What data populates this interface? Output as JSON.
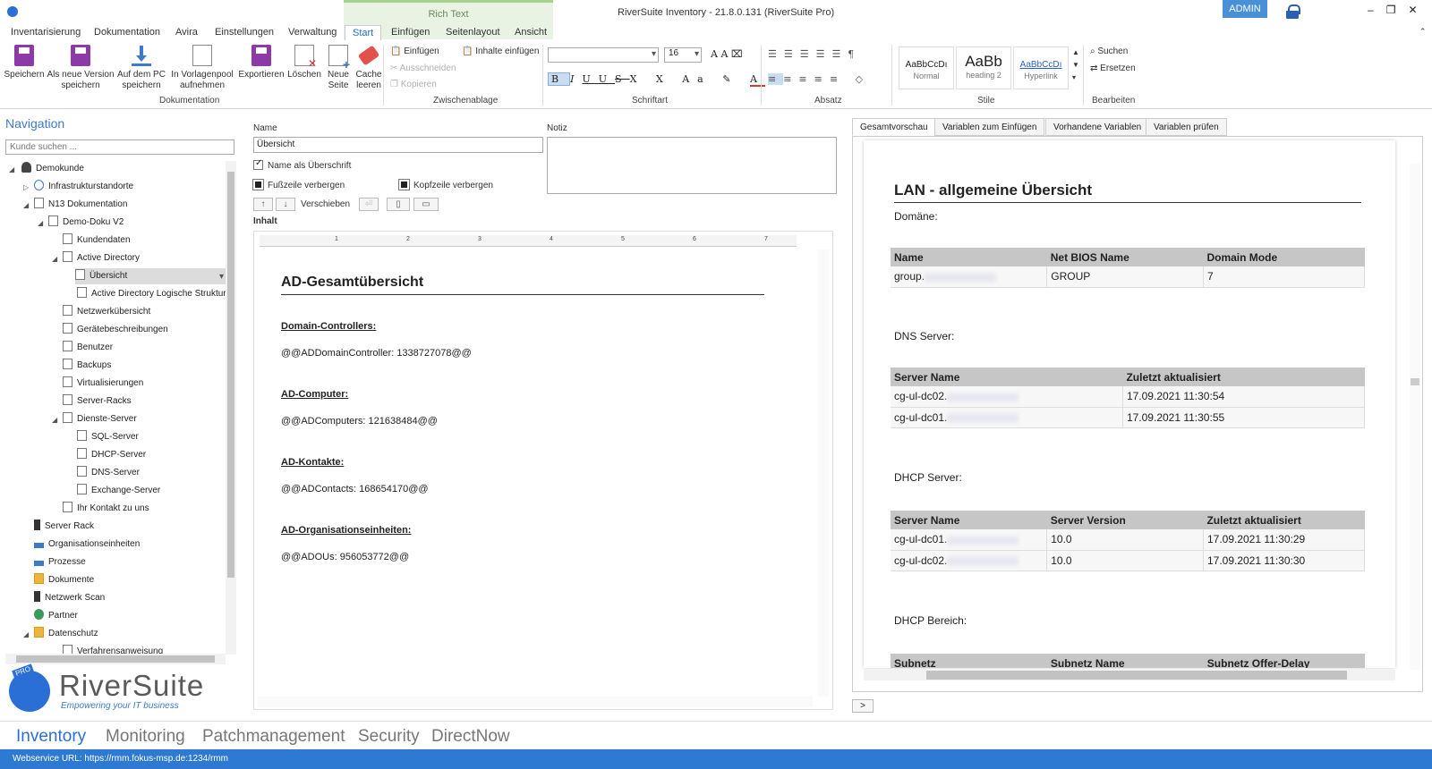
{
  "window": {
    "title": "RiverSuite Inventory - 21.8.0.131 (RiverSuite Pro)",
    "admin_label": "ADMIN",
    "context_title": "Rich Text"
  },
  "menu_tabs": [
    "Inventarisierung",
    "Dokumentation",
    "Avira",
    "Einstellungen",
    "Verwaltung",
    "Start",
    "Einfügen",
    "Seitenlayout",
    "Ansicht"
  ],
  "ribbon": {
    "doc_buttons": [
      {
        "label1": "Speichern",
        "label2": ""
      },
      {
        "label1": "Als neue Version",
        "label2": "speichern"
      },
      {
        "label1": "Auf dem PC",
        "label2": "speichern"
      },
      {
        "label1": "In Vorlagenpool",
        "label2": "aufnehmen"
      },
      {
        "label1": "Exportieren",
        "label2": ""
      },
      {
        "label1": "Löschen",
        "label2": ""
      },
      {
        "label1": "Neue",
        "label2": "Seite"
      },
      {
        "label1": "Cache",
        "label2": "leeren"
      }
    ],
    "group_doc": "Dokumentation",
    "clipboard": {
      "paste": "Einfügen",
      "cut": "Ausschneiden",
      "copy": "Kopieren",
      "paste_content": "Inhalte einfügen",
      "group": "Zwischenablage"
    },
    "font": {
      "size": "16",
      "group": "Schriftart"
    },
    "paragraph_group": "Absatz",
    "styles": [
      {
        "preview": "AaBbCcDı",
        "name": "Normal"
      },
      {
        "preview": "AaBb",
        "name": "heading 2"
      },
      {
        "preview": "AaBbCcDı",
        "name": "Hyperlink"
      }
    ],
    "styles_group": "Stile",
    "edit": {
      "search": "Suchen",
      "replace": "Ersetzen",
      "group": "Bearbeiten"
    }
  },
  "navigation": {
    "title": "Navigation",
    "search_placeholder": "Kunde suchen ...",
    "tree": [
      "Demokunde",
      "Infrastrukturstandorte",
      "N13 Dokumentation",
      "Demo-Doku V2",
      "Kundendaten",
      "Active Directory",
      "Übersicht",
      "Active Directory Logische Struktur",
      "Netzwerkübersicht",
      "Gerätebeschreibungen",
      "Benutzer",
      "Backups",
      "Virtualisierungen",
      "Server-Racks",
      "Dienste-Server",
      "SQL-Server",
      "DHCP-Server",
      "DNS-Server",
      "Exchange-Server",
      "Ihr Kontakt zu uns",
      "Server Rack",
      "Organisationseinheiten",
      "Prozesse",
      "Dokumente",
      "Netzwerk Scan",
      "Partner",
      "Datenschutz",
      "Verfahrensanweisung"
    ]
  },
  "logo": {
    "name": "RiverSuite",
    "tagline": "Empowering your IT business",
    "badge": "PRO"
  },
  "editor_form": {
    "name_label": "Name",
    "name_value": "Übersicht",
    "note_label": "Notiz",
    "chk_name_heading": "Name als Überschrift",
    "chk_hide_footer": "Fußzeile verbergen",
    "chk_hide_header": "Kopfzeile verbergen",
    "move_label": "Verschieben",
    "content_label": "Inhalt"
  },
  "ruler_numbers": [
    "1",
    "2",
    "3",
    "4",
    "5",
    "6",
    "7"
  ],
  "document": {
    "title": "AD-Gesamtübersicht",
    "sections": [
      {
        "heading": "Domain-Controllers:",
        "text": "@@ADDomainController: 1338727078@@"
      },
      {
        "heading": "AD-Computer:",
        "text": "@@ADComputers: 121638484@@"
      },
      {
        "heading": "AD-Kontakte:",
        "text": "@@ADContacts: 168654170@@"
      },
      {
        "heading": "AD-Organisationseinheiten:",
        "text": "@@ADOUs: 956053772@@"
      }
    ]
  },
  "preview_tabs": [
    "Gesamtvorschau",
    "Variablen zum Einfügen",
    "Vorhandene Variablen",
    "Variablen prüfen"
  ],
  "preview": {
    "title": "LAN - allgemeine Übersicht",
    "domain_label": "Domäne:",
    "domain_table": {
      "headers": [
        "Name",
        "Net BIOS Name",
        "Domain Mode"
      ],
      "rows": [
        [
          "group.",
          "GROUP",
          "7"
        ]
      ]
    },
    "dns_label": "DNS Server:",
    "dns_table": {
      "headers": [
        "Server Name",
        "Zuletzt aktualisiert"
      ],
      "rows": [
        [
          "cg-ul-dc02.",
          "17.09.2021 11:30:54"
        ],
        [
          "cg-ul-dc01.",
          "17.09.2021 11:30:55"
        ]
      ]
    },
    "dhcp_label": "DHCP Server:",
    "dhcp_table": {
      "headers": [
        "Server Name",
        "Server Version",
        "Zuletzt aktualisiert"
      ],
      "rows": [
        [
          "cg-ul-dc01.",
          "10.0",
          "17.09.2021 11:30:29"
        ],
        [
          "cg-ul-dc02.",
          "10.0",
          "17.09.2021 11:30:30"
        ]
      ]
    },
    "dhcp_range_label": "DHCP Bereich:",
    "subnet_headers": [
      "Subnetz",
      "Subnetz Name",
      "Subnetz Offer-Delay"
    ]
  },
  "bottom_nav": [
    "Inventory",
    "Monitoring",
    "Patchmanagement",
    "Security",
    "DirectNow"
  ],
  "status": {
    "text": "Webservice URL: https://rmm.fokus-msp.de:1234/rmm"
  },
  "colors": {
    "accent": "#2e7ad2",
    "context": "#e9f3e3"
  }
}
